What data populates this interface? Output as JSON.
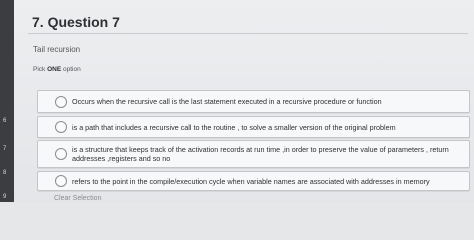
{
  "question": {
    "title": "7. Question 7",
    "text": "Tail recursion",
    "instruction_prefix": "Pick ",
    "instruction_bold": "ONE",
    "instruction_suffix": " option"
  },
  "options": [
    "Occurs when the recursive call is the last statement executed in a recursive procedure or function",
    "is a path that includes a recursive call to the routine , to solve a smaller version of the original problem",
    "is a structure that keeps track of the activation records at run time ,in order to preserve the value of parameters , return addresses ,registers and so no",
    "refers to the point in the compile/execution cycle when variable names are associated with addresses in memory"
  ],
  "clear_selection": "Clear Selection",
  "row_numbers": [
    "6",
    "7",
    "8",
    "9"
  ]
}
